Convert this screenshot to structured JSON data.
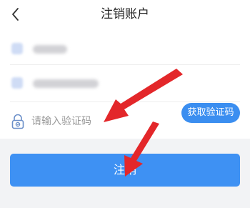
{
  "header": {
    "title": "注销账户",
    "back_icon": "chevron-left-icon"
  },
  "form": {
    "get_code_label": "获取验证码",
    "code_placeholder": "请输入验证码",
    "lock_icon": "lock-icon"
  },
  "actions": {
    "submit_label": "注销"
  },
  "colors": {
    "accent": "#3e91f3",
    "arrow": "#e3272a",
    "background": "#f2f3f5"
  }
}
